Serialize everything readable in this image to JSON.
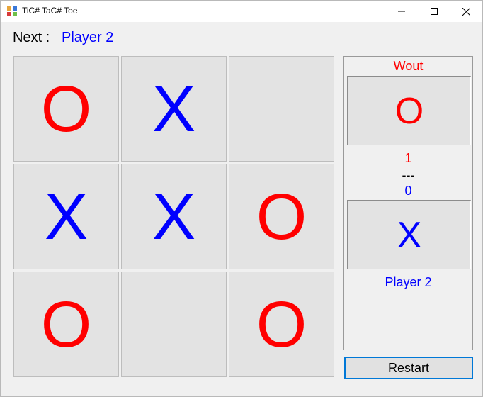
{
  "window": {
    "title": "TiC# TaC# Toe",
    "controls": [
      "minimize",
      "maximize",
      "close"
    ]
  },
  "status": {
    "next_label": "Next :",
    "next_player": "Player 2"
  },
  "board": {
    "cells": [
      "O",
      "X",
      "",
      "X",
      "X",
      "O",
      "O",
      "",
      "O"
    ]
  },
  "scoreboard": {
    "player1": {
      "name": "Wout",
      "symbol": "O",
      "score": "1",
      "color": "#ff0000"
    },
    "separator": "---",
    "player2": {
      "name": "Player 2",
      "symbol": "X",
      "score": "0",
      "color": "#0000ff"
    }
  },
  "buttons": {
    "restart": "Restart"
  },
  "colors": {
    "o_color": "#ff0000",
    "x_color": "#0000ff",
    "accent": "#0078d7"
  }
}
